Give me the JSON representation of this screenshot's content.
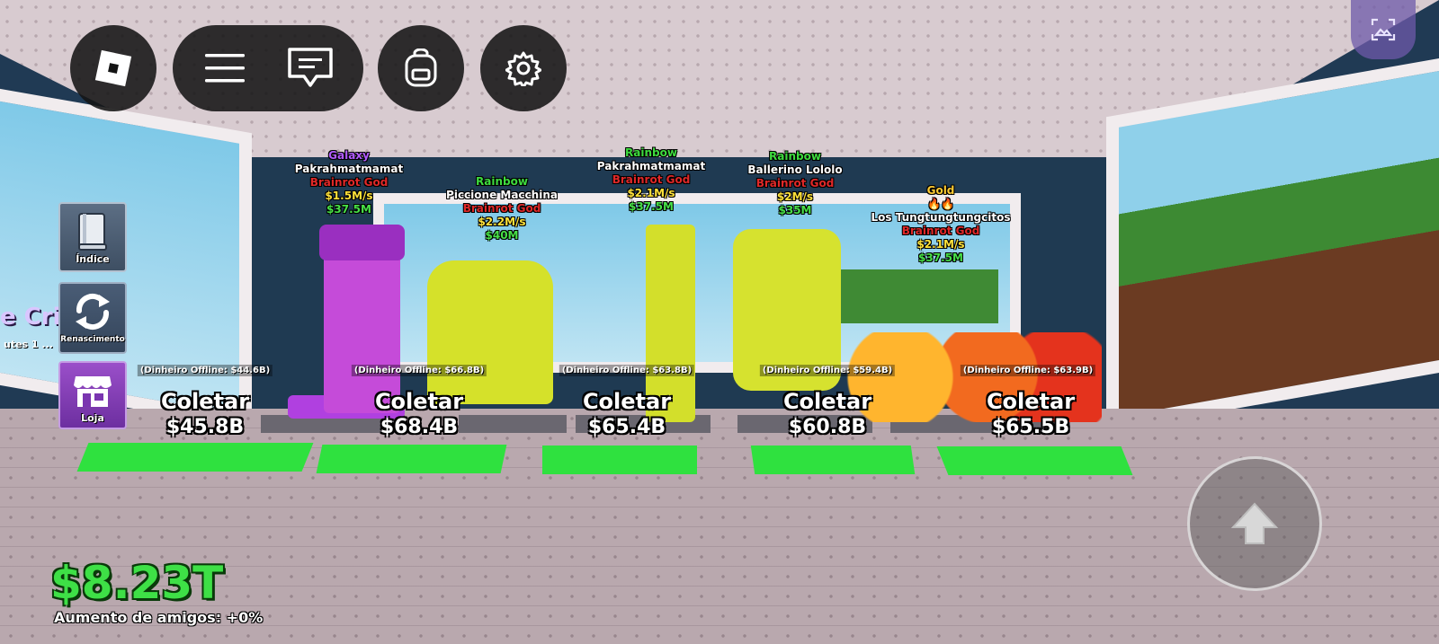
{
  "hud": {
    "roblox_icon": "roblox-logo-icon",
    "menu_icon": "hamburger-menu-icon",
    "chat_icon": "chat-icon",
    "backpack_icon": "backpack-icon",
    "settings_icon": "gear-icon",
    "capture_icon": "screenshot-capture-icon"
  },
  "side_menu": {
    "indice_label": "Índice",
    "renascimento_label": "Renascimento",
    "loja_label": "Loja"
  },
  "partial_text": {
    "crias": "e Cria",
    "crias_sub": "utes 1 ..."
  },
  "brainrots": [
    {
      "rarity": "Galaxy",
      "name": "Pakrahmatmamat",
      "tier": "Brainrot God",
      "rate": "$1.5M/s",
      "price": "$37.5M",
      "offline": "(Dinheiro Offline: $44.6B)",
      "collect": "Coletar",
      "amount": "$45.8B"
    },
    {
      "rarity": "Rainbow",
      "name": "Piccione Macchina",
      "tier": "Brainrot God",
      "rate": "$2.2M/s",
      "price": "$40M",
      "offline": "(Dinheiro Offline: $66.8B)",
      "collect": "Coletar",
      "amount": "$68.4B"
    },
    {
      "rarity": "Rainbow",
      "name": "Pakrahmatmamat",
      "tier": "Brainrot God",
      "rate": "$2.1M/s",
      "price": "$37.5M",
      "offline": "(Dinheiro Offline: $63.8B)",
      "collect": "Coletar",
      "amount": "$65.4B"
    },
    {
      "rarity": "Rainbow",
      "name": "Ballerino Lololo",
      "tier": "Brainrot God",
      "rate": "$2M/s",
      "price": "$35M",
      "offline": "(Dinheiro Offline: $59.4B)",
      "collect": "Coletar",
      "amount": "$60.8B"
    },
    {
      "rarity": "Gold",
      "mutation_icons": "🔥🔥",
      "name": "Los Tungtungtungcitos",
      "tier": "Brainrot God",
      "rate": "$2.1M/s",
      "price": "$37.5M",
      "offline": "(Dinheiro Offline: $63.9B)",
      "collect": "Coletar",
      "amount": "$65.5B"
    }
  ],
  "wallet": {
    "money": "$8.23T",
    "friends_boost": "Aumento de amigos: +0%"
  },
  "controls": {
    "jump_icon": "arrow-up-icon"
  },
  "colors": {
    "pad_green": "#2fe13f",
    "money_green": "#3ee046",
    "galaxy": "#b25cff",
    "rainbow": "#3edb3e",
    "gold": "#ffcc33",
    "god_red": "#e02828"
  }
}
